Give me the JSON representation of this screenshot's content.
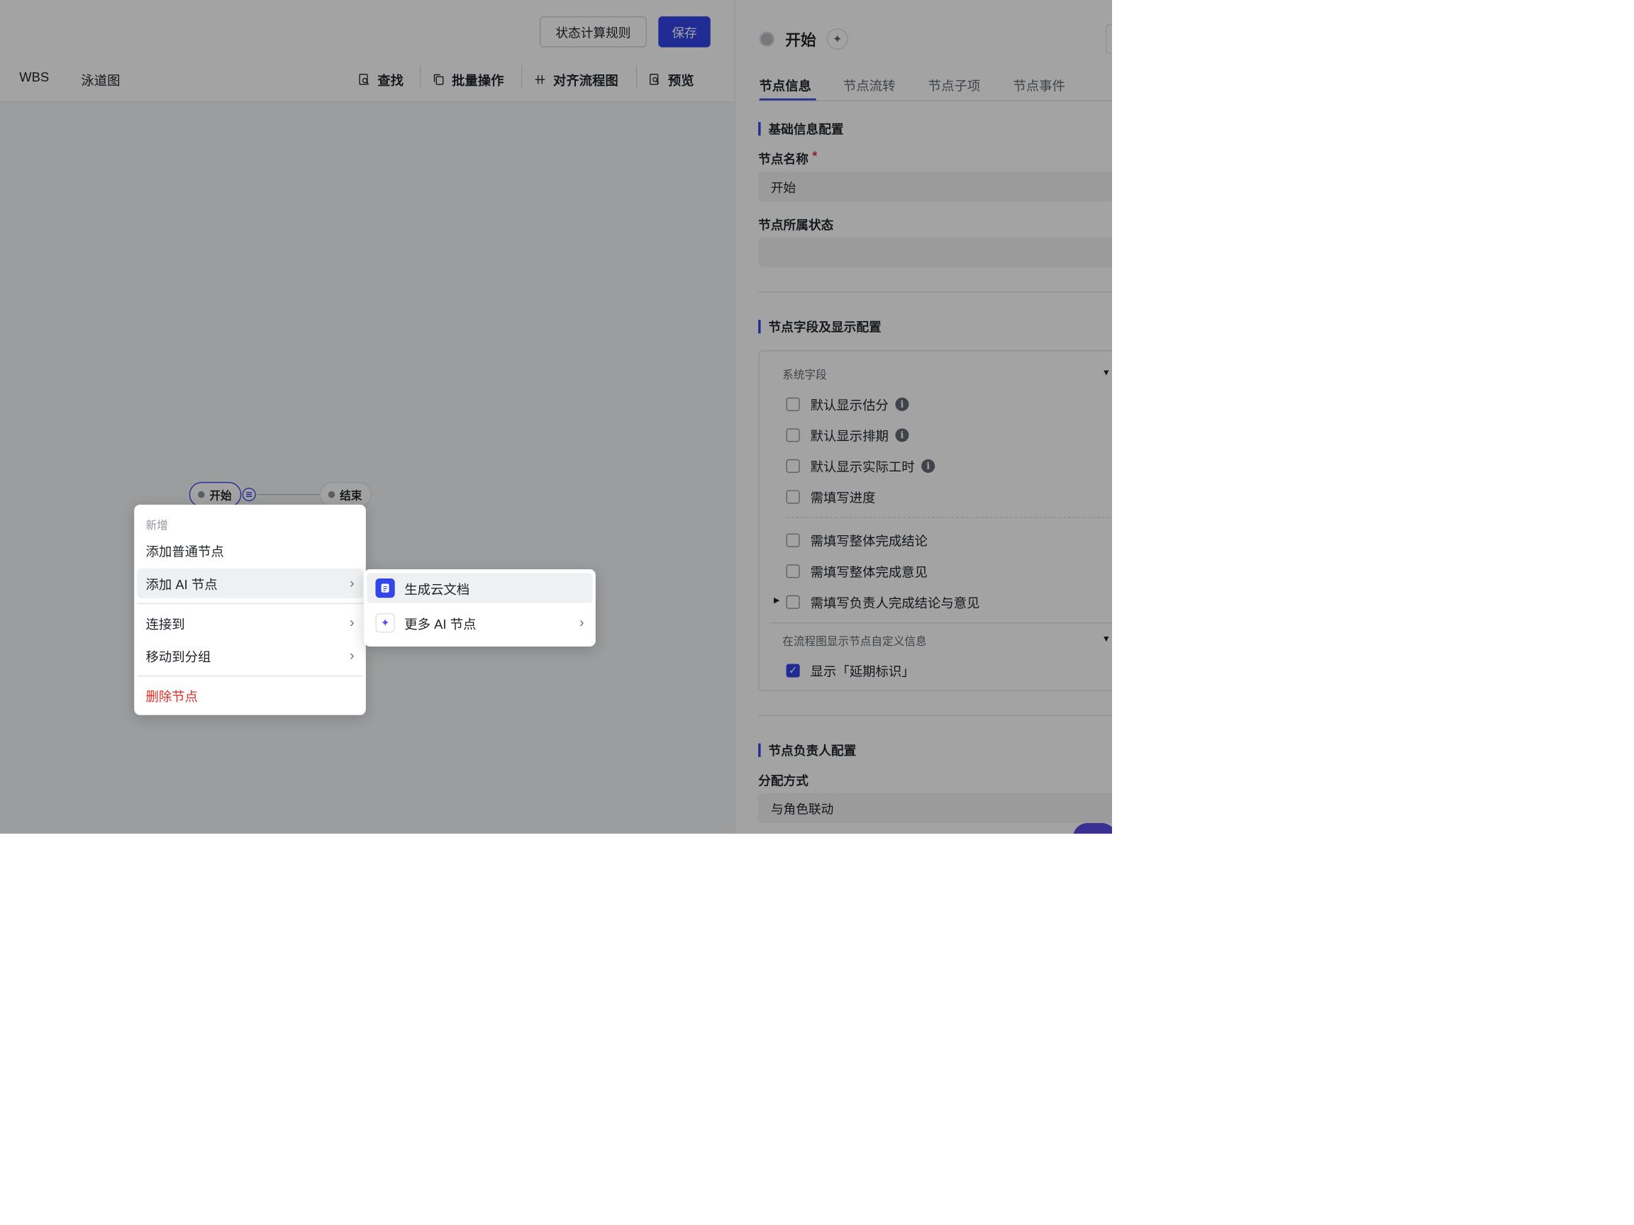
{
  "toolbar": {
    "status_rule_label": "状态计算规则",
    "save_label": "保存"
  },
  "views": [
    "WBS",
    "泳道图"
  ],
  "tools": {
    "find": "查找",
    "batch": "批量操作",
    "align": "对齐流程图",
    "preview": "预览"
  },
  "flow": {
    "start_label": "开始",
    "end_label": "结束"
  },
  "context_menu": {
    "group_label": "新增",
    "add_normal": "添加普通节点",
    "add_ai": "添加 AI 节点",
    "connect_to": "连接到",
    "move_to_group": "移动到分组",
    "delete_node": "删除节点"
  },
  "ai_submenu": {
    "generate_doc": "生成云文档",
    "more_ai": "更多 AI 节点"
  },
  "panel": {
    "node_title": "开始",
    "tabs": [
      "节点信息",
      "节点流转",
      "节点子项",
      "节点事件"
    ],
    "basic_section": "基础信息配置",
    "name_label": "节点名称",
    "required_mark": "*",
    "name_value": "开始",
    "status_label": "节点所属状态",
    "status_value": "",
    "fields_section": "节点字段及显示配置",
    "system_fields_label": "系统字段",
    "system_fields": [
      {
        "label": "默认显示估分",
        "info": true,
        "checked": false
      },
      {
        "label": "默认显示排期",
        "info": true,
        "checked": false
      },
      {
        "label": "默认显示实际工时",
        "info": true,
        "checked": false
      },
      {
        "label": "需填写进度",
        "info": false,
        "checked": false
      },
      {
        "label": "需填写整体完成结论",
        "info": false,
        "checked": false
      },
      {
        "label": "需填写整体完成意见",
        "info": false,
        "checked": false
      },
      {
        "label": "需填写负责人完成结论与意见",
        "info": false,
        "checked": false
      }
    ],
    "custom_info_label": "在流程图显示节点自定义信息",
    "show_delay_label": "显示「延期标识」",
    "show_delay_checked": true,
    "owner_section": "节点负责人配置",
    "assign_label": "分配方式",
    "assign_value": "与角色联动"
  },
  "colors": {
    "primary": "#3346e8",
    "danger": "#e22e28",
    "overlay": "rgba(0,0,0,0.36)"
  }
}
